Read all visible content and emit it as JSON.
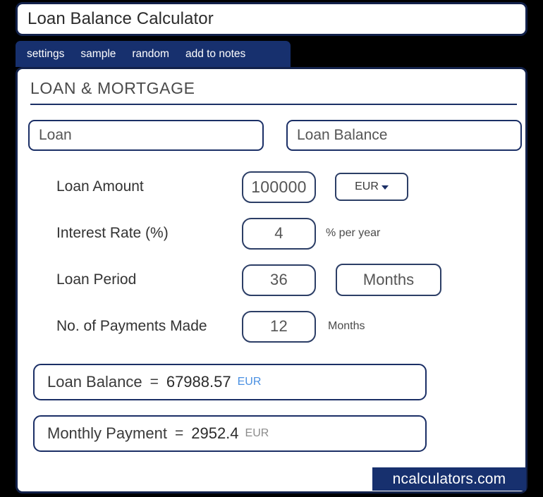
{
  "window": {
    "title": "Loan Balance Calculator"
  },
  "nav": {
    "items": [
      {
        "label": "settings"
      },
      {
        "label": "sample"
      },
      {
        "label": "random"
      },
      {
        "label": "add to notes"
      }
    ]
  },
  "section": {
    "heading": "LOAN & MORTGAGE"
  },
  "selectors": {
    "category": "Loan",
    "calculation": "Loan Balance"
  },
  "form": {
    "loan_amount": {
      "label": "Loan Amount",
      "value": "100000",
      "currency": "EUR",
      "currency_icon": "chevron-down-icon"
    },
    "interest_rate": {
      "label": "Interest Rate (%)",
      "value": "4",
      "unit": "% per year"
    },
    "loan_period": {
      "label": "Loan Period",
      "value": "36",
      "unit": "Months"
    },
    "payments_made": {
      "label": "No. of Payments Made",
      "value": "12",
      "unit": "Months"
    }
  },
  "results": {
    "loan_balance": {
      "label": "Loan Balance",
      "equals": "=",
      "value": "67988.57",
      "unit": "EUR",
      "unit_color": "#4a90e2"
    },
    "monthly_payment": {
      "label": "Monthly Payment",
      "equals": "=",
      "value": "2952.4",
      "unit": "EUR",
      "unit_color": "#8c8c8c"
    }
  },
  "footer": {
    "brand": "ncalculators.com"
  },
  "theme": {
    "navy": "#17306e",
    "border_navy": "#1b2f66",
    "accent_blue": "#4a90e2",
    "background": "#000000",
    "panel": "#ffffff"
  }
}
